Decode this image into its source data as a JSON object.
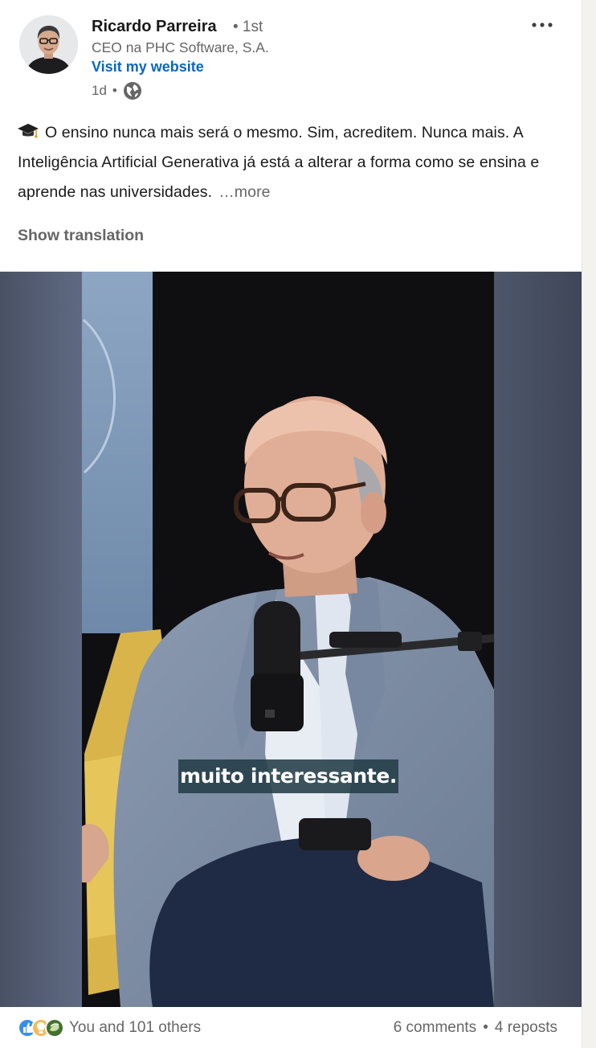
{
  "author": {
    "name": "Ricardo Parreira",
    "degree": "• 1st",
    "headline": "CEO na PHC Software, S.A.",
    "website_label": "Visit my website",
    "time": "1d",
    "dot": "•",
    "visibility_icon": "globe-icon"
  },
  "post": {
    "lead_icon": "graduation-cap-icon",
    "text": "O ensino nunca mais será o mesmo. Sim, acreditem. Nunca mais. A Inteligência Artificial Generativa já está a alterar a forma como se ensina e aprende nas universidades.",
    "see_more": "…more",
    "translation_label": "Show translation"
  },
  "video": {
    "caption": "muito interessante."
  },
  "social": {
    "reaction_icons": [
      "like-icon",
      "insightful-icon",
      "support-icon"
    ],
    "reactions_label": "You and 101 others",
    "comments": "6 comments",
    "separator": "•",
    "reposts": "4 reposts"
  },
  "colors": {
    "link": "#0a66c2",
    "secondary_text": "#666666",
    "caption_bg": "#233e48"
  }
}
